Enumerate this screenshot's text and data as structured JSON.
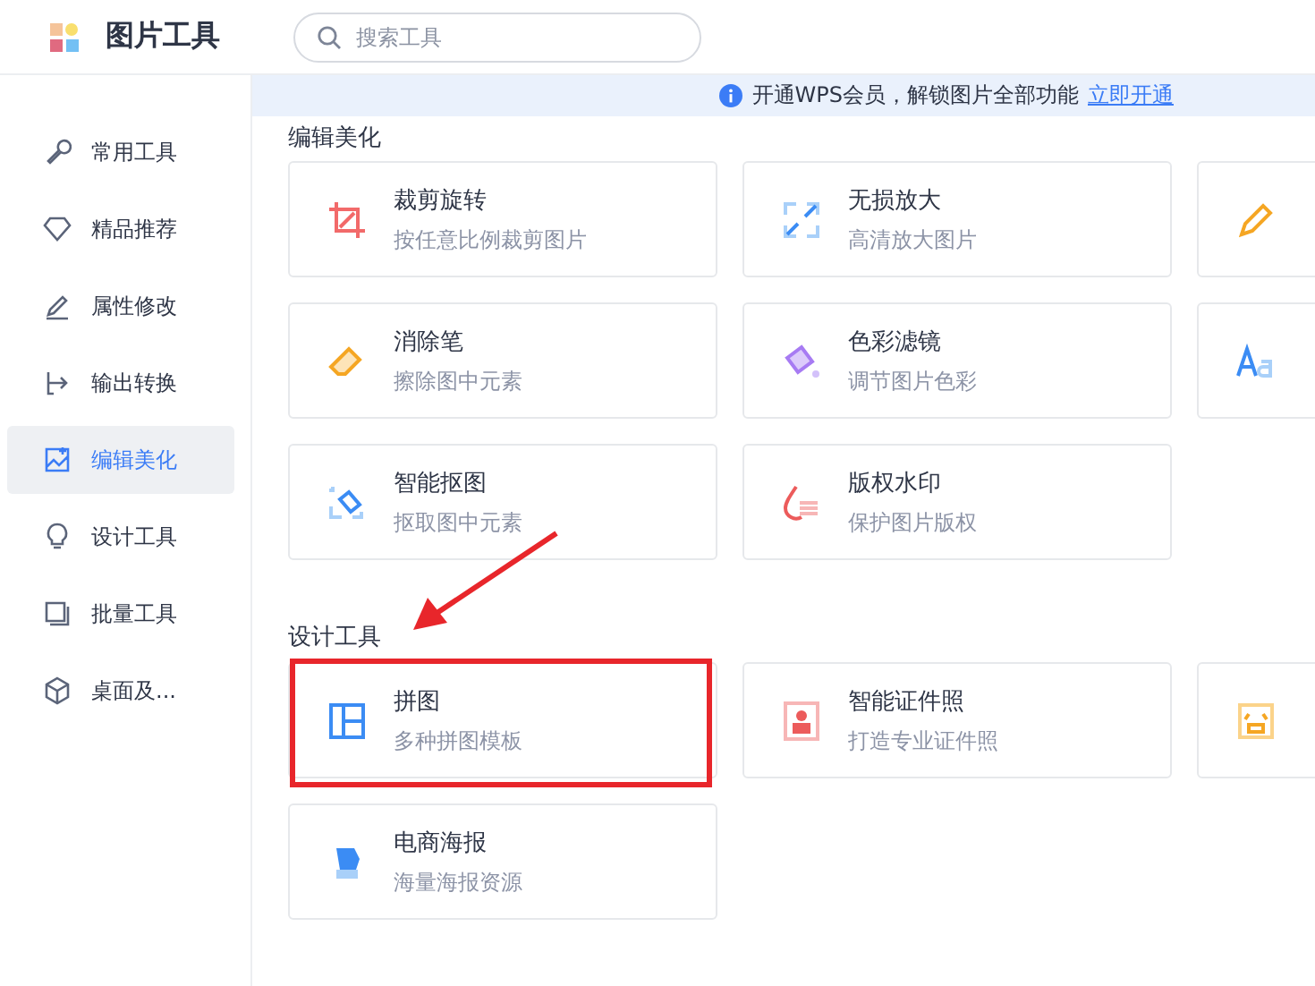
{
  "header": {
    "title": "图片工具",
    "search": {
      "placeholder": "搜索工具"
    }
  },
  "sidebar": {
    "items": [
      {
        "label": "常用工具",
        "selected": false
      },
      {
        "label": "精品推荐",
        "selected": false
      },
      {
        "label": "属性修改",
        "selected": false
      },
      {
        "label": "输出转换",
        "selected": false
      },
      {
        "label": "编辑美化",
        "selected": true
      },
      {
        "label": "设计工具",
        "selected": false
      },
      {
        "label": "批量工具",
        "selected": false
      },
      {
        "label": "桌面及...",
        "selected": false
      }
    ]
  },
  "banner": {
    "text": "开通WPS会员，解锁图片全部功能",
    "link": "立即开通"
  },
  "sections": [
    {
      "title": "编辑美化",
      "cards": [
        {
          "title": "裁剪旋转",
          "subtitle": "按任意比例裁剪图片",
          "highlighted": false
        },
        {
          "title": "无损放大",
          "subtitle": "高清放大图片",
          "highlighted": false
        },
        {
          "highlighted": false
        },
        {
          "title": "消除笔",
          "subtitle": "擦除图中元素",
          "highlighted": false
        },
        {
          "title": "色彩滤镜",
          "subtitle": "调节图片色彩",
          "highlighted": false
        },
        {
          "highlighted": false
        },
        {
          "title": "智能抠图",
          "subtitle": "抠取图中元素",
          "highlighted": false
        },
        {
          "title": "版权水印",
          "subtitle": "保护图片版权",
          "highlighted": false
        }
      ]
    },
    {
      "title": "设计工具",
      "cards": [
        {
          "title": "拼图",
          "subtitle": "多种拼图模板",
          "highlighted": true
        },
        {
          "title": "智能证件照",
          "subtitle": "打造专业证件照",
          "highlighted": false
        },
        {
          "highlighted": false
        },
        {
          "title": "电商海报",
          "subtitle": "海量海报资源",
          "highlighted": false
        }
      ]
    }
  ]
}
